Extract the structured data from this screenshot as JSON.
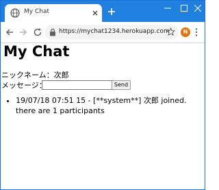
{
  "browser": {
    "tab_title": "My Chat",
    "url": "https://mychat1234.herokuapp.com",
    "profile_initial": "N"
  },
  "page": {
    "title": "My Chat",
    "nickname_label": "ニックネーム：",
    "nickname_value": "次郎",
    "message_label": "メッセージ：",
    "message_value": "",
    "send_label": "Send"
  },
  "messages": [
    "19/07/18 07:51 15 - [**system**] 次郎 joined. there are 1 participants"
  ]
}
